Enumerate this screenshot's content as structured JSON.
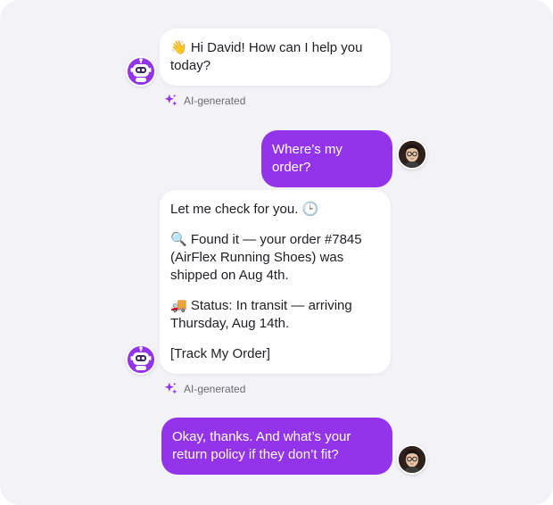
{
  "colors": {
    "accent": "#9333ea",
    "background": "#f3f3f7",
    "bot_bubble": "#ffffff",
    "ai_label_text": "#6b6b78"
  },
  "messages": [
    {
      "sender": "bot",
      "paragraphs": [
        "👋 Hi David! How can I help you today?"
      ],
      "ai_label": "AI-generated",
      "icon": "robot-icon"
    },
    {
      "sender": "user",
      "paragraphs": [
        "Where’s my order?"
      ],
      "icon": "user-avatar"
    },
    {
      "sender": "bot",
      "paragraphs": [
        "Let me check for you. 🕒",
        "🔍 Found it — your order #7845 (AirFlex Running Shoes) was shipped on Aug 4th.",
        "🚚 Status: In transit — arriving Thursday, Aug 14th.",
        "[Track My Order]"
      ],
      "ai_label": "AI-generated",
      "icon": "robot-icon"
    },
    {
      "sender": "user",
      "paragraphs": [
        "Okay, thanks. And what’s your return policy if they don’t fit?"
      ],
      "icon": "user-avatar"
    }
  ]
}
